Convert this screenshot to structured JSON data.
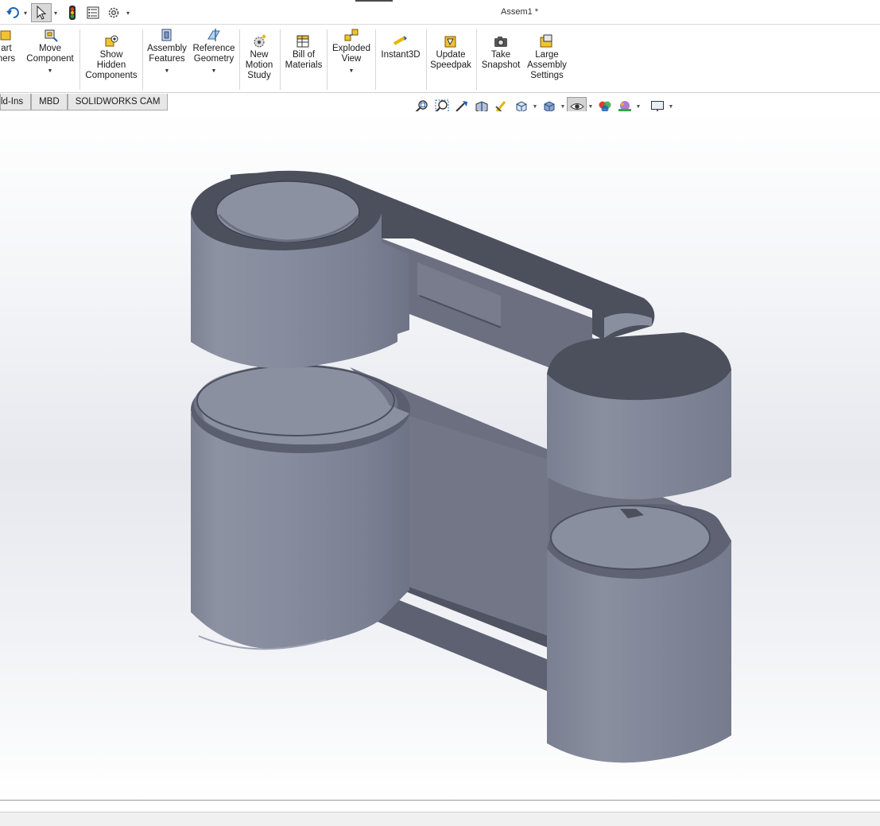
{
  "window": {
    "title": "Assem1 *"
  },
  "quick_access": {
    "undo_icon": "undo-icon",
    "select_icon": "select-arrow-icon",
    "rebuild_icon": "traffic-light-icon",
    "file_properties_icon": "file-properties-icon",
    "options_icon": "gear-icon"
  },
  "ribbon": {
    "buttons": [
      {
        "id": "insert-components",
        "label": [
          "art",
          "ners"
        ],
        "icon": "insert-components-icon",
        "has_dropdown": false
      },
      {
        "id": "move-component",
        "label": [
          "Move",
          "Component"
        ],
        "icon": "move-component-icon",
        "has_dropdown": true
      },
      {
        "id": "show-hidden",
        "label": [
          "Show",
          "Hidden",
          "Components"
        ],
        "icon": "show-hidden-icon",
        "has_dropdown": false
      },
      {
        "id": "assembly-features",
        "label": [
          "Assembly",
          "Features"
        ],
        "icon": "assembly-features-icon",
        "has_dropdown": true
      },
      {
        "id": "reference-geometry",
        "label": [
          "Reference",
          "Geometry"
        ],
        "icon": "reference-geometry-icon",
        "has_dropdown": true
      },
      {
        "id": "new-motion-study",
        "label": [
          "New",
          "Motion",
          "Study"
        ],
        "icon": "motion-study-icon",
        "has_dropdown": false
      },
      {
        "id": "bill-of-materials",
        "label": [
          "Bill of",
          "Materials"
        ],
        "icon": "bom-icon",
        "has_dropdown": false
      },
      {
        "id": "exploded-view",
        "label": [
          "Exploded",
          "View"
        ],
        "icon": "exploded-view-icon",
        "has_dropdown": true
      },
      {
        "id": "instant3d",
        "label": [
          "Instant3D"
        ],
        "icon": "instant3d-icon",
        "has_dropdown": false
      },
      {
        "id": "update-speedpak",
        "label": [
          "Update",
          "Speedpak"
        ],
        "icon": "speedpak-icon",
        "has_dropdown": false
      },
      {
        "id": "take-snapshot",
        "label": [
          "Take",
          "Snapshot"
        ],
        "icon": "camera-icon",
        "has_dropdown": false
      },
      {
        "id": "large-assembly-settings",
        "label": [
          "Large",
          "Assembly",
          "Settings"
        ],
        "icon": "large-assembly-icon",
        "has_dropdown": false
      }
    ]
  },
  "tabs": [
    {
      "label": "ld-Ins"
    },
    {
      "label": "MBD"
    },
    {
      "label": "SOLIDWORKS CAM"
    }
  ],
  "view_toolbar": {
    "items": [
      "zoom-to-fit-icon",
      "zoom-to-area-icon",
      "previous-view-icon",
      "section-view-icon",
      "dynamic-annotation-icon",
      "view-orientation-icon",
      "display-style-icon",
      "hide-show-items-icon",
      "edit-appearance-icon",
      "apply-scene-icon",
      "view-settings-icon"
    ]
  },
  "colors": {
    "model_dark": "#4c4f5c",
    "model_mid": "#6a6e80",
    "model_light": "#9095a6",
    "accent_yellow": "#e9b400"
  }
}
